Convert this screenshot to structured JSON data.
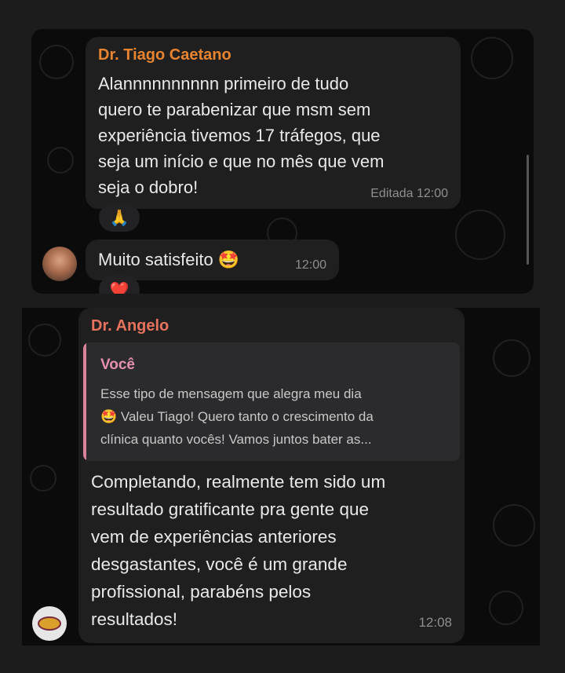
{
  "messages": [
    {
      "sender": "Dr. Tiago Caetano",
      "sender_color": "#e8842f",
      "text": "Alannnnnnnnnn primeiro de tudo\nquero te parabenizar que msm sem\nexperiência tivemos 17 tráfegos, que\nseja um início e que no mês que vem\nseja o dobro!",
      "meta": "Editada 12:00",
      "reaction": "🙏"
    },
    {
      "text": "Muito satisfeito 🤩",
      "time": "12:00",
      "reaction": "❤️"
    },
    {
      "sender": "Dr. Angelo",
      "sender_color": "#e7735f",
      "reply": {
        "author": "Você",
        "text": "Esse tipo de mensagem que alegra meu dia\n🤩 Valeu Tiago! Quero tanto o crescimento da\nclínica quanto vocês! Vamos juntos bater as..."
      },
      "text": "Completando, realmente tem sido um\nresultado gratificante pra gente que\nvem de experiências anteriores\ndesgastantes, você é um grande\nprofissional, parabéns pelos\nresultados!",
      "time": "12:08"
    }
  ],
  "colors": {
    "bubble": "#1f1f20",
    "chat_background": "#0b0b0b",
    "quote_bar": "#d9839c"
  }
}
